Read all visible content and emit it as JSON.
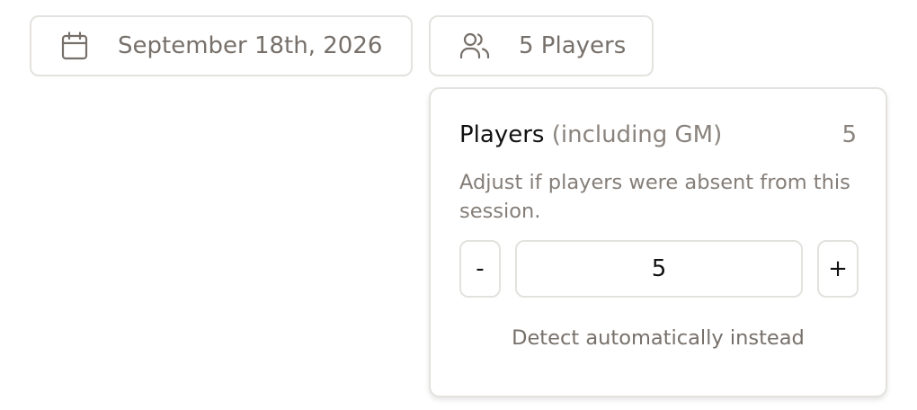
{
  "date_button": {
    "label": "September 18th, 2026",
    "icon": "calendar-icon"
  },
  "players_button": {
    "label": "5 Players",
    "icon": "users-icon"
  },
  "popover": {
    "title": "Players",
    "title_suffix": "(including GM)",
    "count": "5",
    "description": "Adjust if players were absent from this session.",
    "decrement_label": "-",
    "value": "5",
    "increment_label": "+",
    "detect_label": "Detect automatically instead"
  },
  "colors": {
    "border": "#e4e2df",
    "muted_text": "#77706a",
    "primary_text": "#111111"
  }
}
